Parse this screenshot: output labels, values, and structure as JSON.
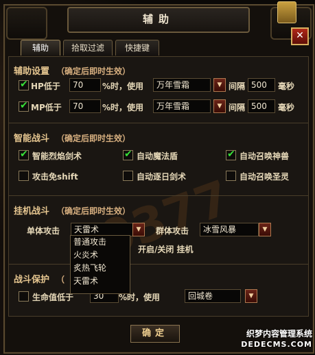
{
  "window": {
    "title": "辅助",
    "close_label": "✕"
  },
  "tabs": [
    {
      "label": "辅助",
      "active": true
    },
    {
      "label": "拾取过滤",
      "active": false
    },
    {
      "label": "快捷键",
      "active": false
    }
  ],
  "assist_settings": {
    "title": "辅助设置",
    "note": "（确定后即时生效）",
    "hp": {
      "checked": true,
      "label": "HP低于",
      "value": "70",
      "suffix": "%时，使用",
      "item": "万年雪霜",
      "interval_label": "间隔",
      "interval": "500",
      "unit": "毫秒"
    },
    "mp": {
      "checked": true,
      "label": "MP低于",
      "value": "70",
      "suffix": "%时，使用",
      "item": "万年雪霜",
      "interval_label": "间隔",
      "interval": "500",
      "unit": "毫秒"
    }
  },
  "smart_combat": {
    "title": "智能战斗",
    "note": "（确定后即时生效）",
    "options": [
      {
        "label": "智能烈焰剑术",
        "checked": true
      },
      {
        "label": "自动魔法盾",
        "checked": true
      },
      {
        "label": "自动召唤神兽",
        "checked": true
      },
      {
        "label": "攻击免shift",
        "checked": false
      },
      {
        "label": "自动逐日剑术",
        "checked": false
      },
      {
        "label": "自动召唤圣灵",
        "checked": false
      }
    ]
  },
  "auto_combat": {
    "title": "挂机战斗",
    "note": "（确定后即时生效）",
    "single_label": "单体攻击",
    "single_value": "天雷术",
    "group_label": "群体攻击",
    "group_value": "冰雪风暴",
    "toggle_label": "开启/关闭 挂机",
    "dropdown_options": [
      "普通攻击",
      "火炎术",
      "炙热飞轮",
      "天雷术"
    ]
  },
  "combat_protect": {
    "title": "战斗保护",
    "note": "（",
    "checked": false,
    "label": "生命值低于",
    "value": "30",
    "suffix": "%时，使用",
    "item": "回城卷"
  },
  "confirm_label": "确定",
  "watermark": {
    "line1": "织梦内容管理系统",
    "line2": "DEDECMS.COM",
    "logo": "0377"
  }
}
